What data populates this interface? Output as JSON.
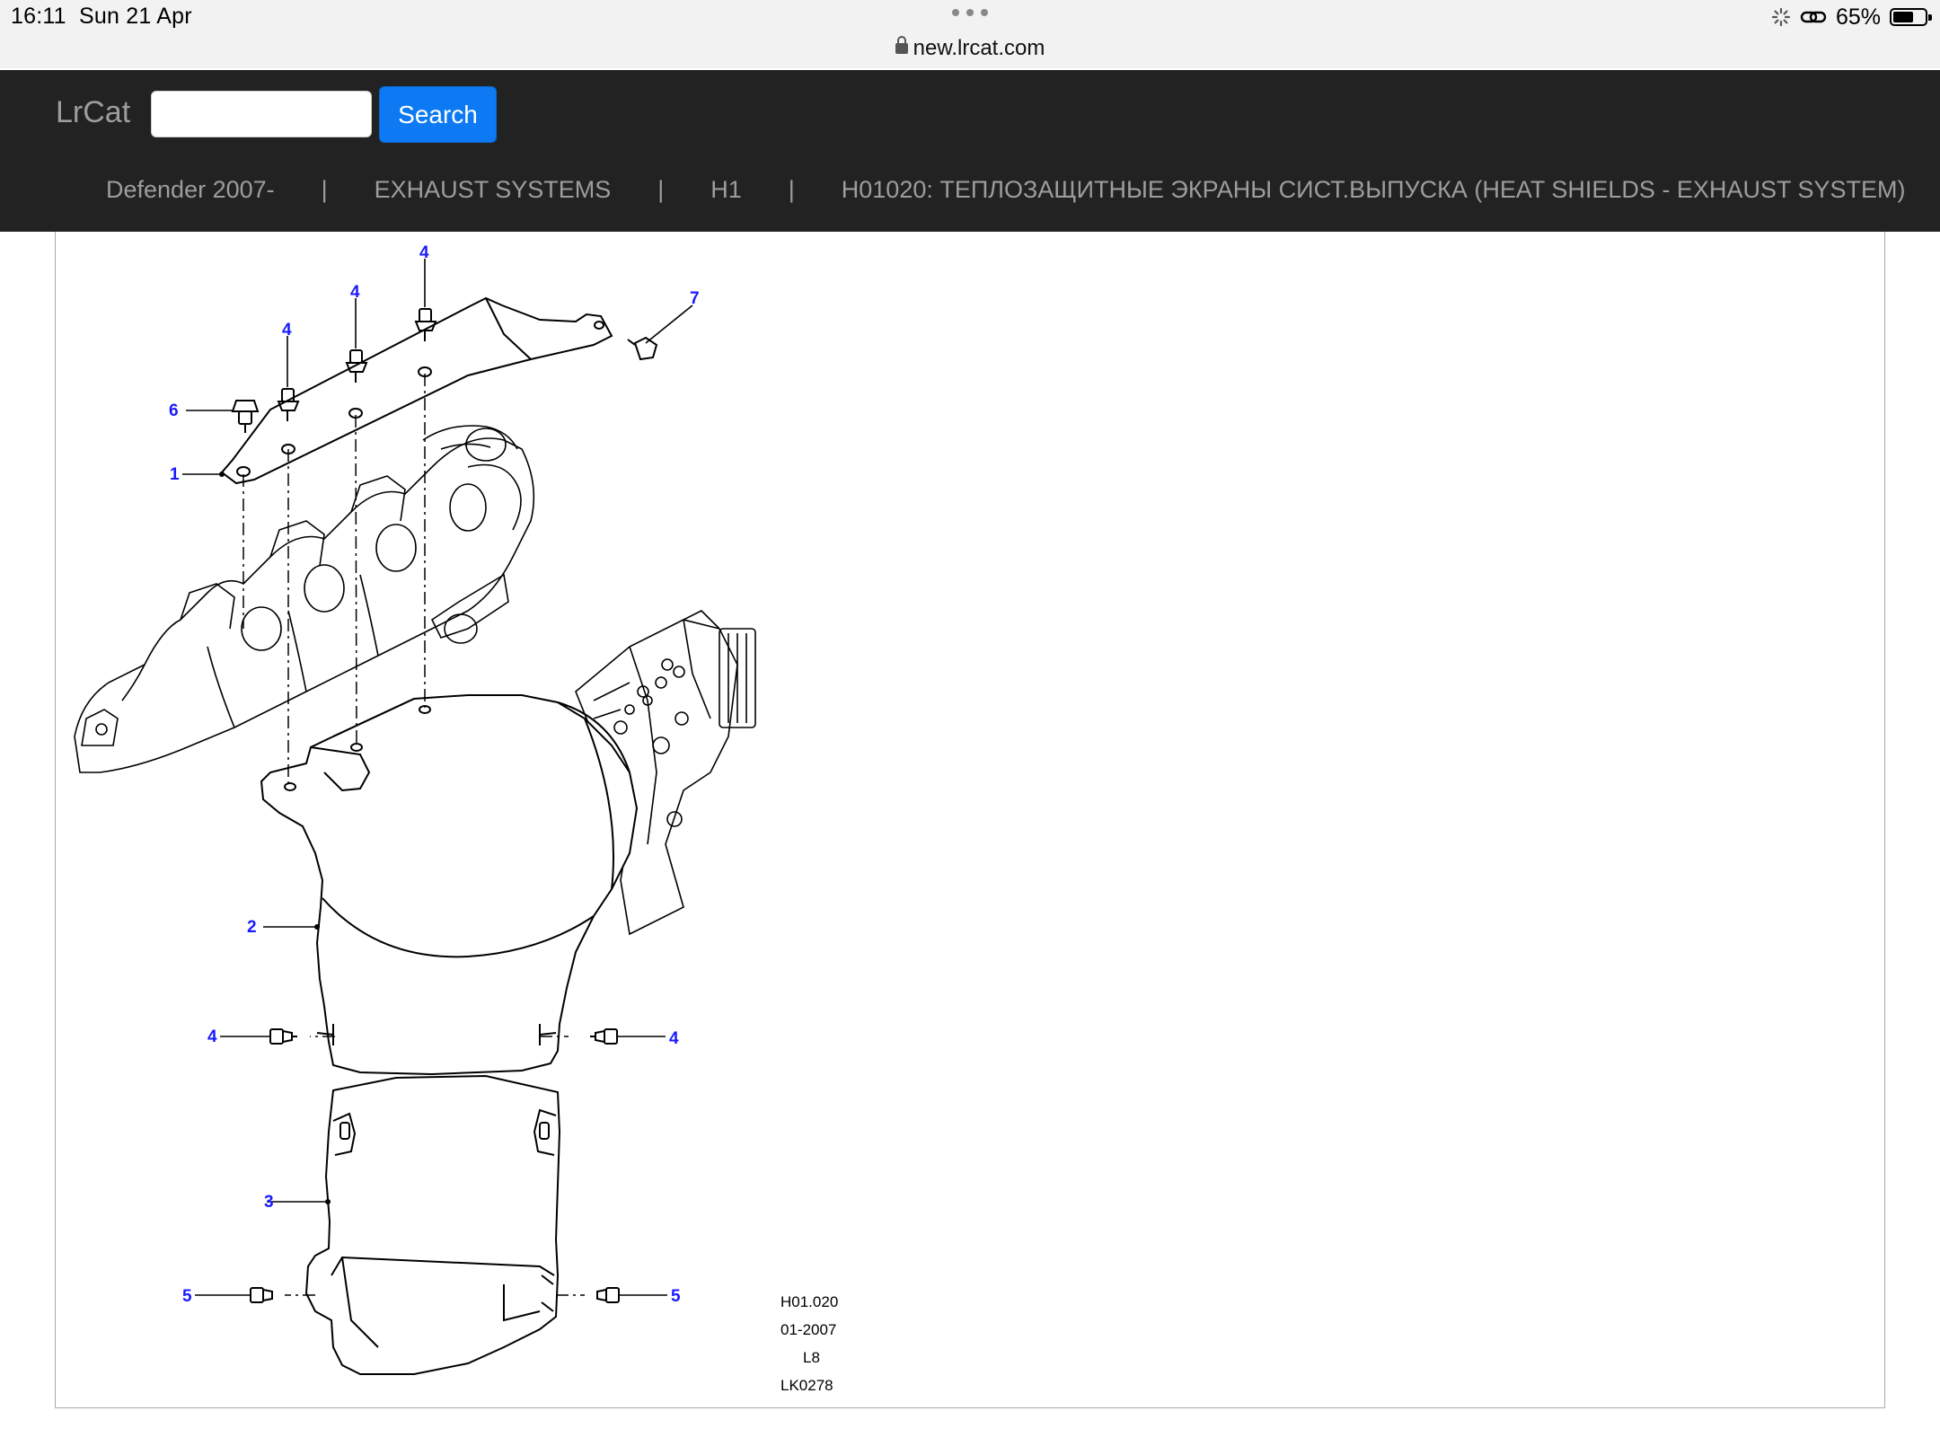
{
  "status_bar": {
    "time": "16:11",
    "date": "Sun 21 Apr",
    "url": "new.lrcat.com",
    "battery": "65%",
    "battery_level": 0.65
  },
  "navbar": {
    "brand": "LrCat",
    "search_placeholder": "",
    "search_button": "Search"
  },
  "breadcrumb": [
    "Defender 2007-",
    "EXHAUST SYSTEMS",
    "H1",
    "H01020: ТЕПЛОЗАЩИТНЫЕ ЭКРАНЫ СИСТ.ВЫПУСКА (HEAT SHIELDS - EXHAUST SYSTEM)"
  ],
  "breadcrumb_separator": "|",
  "diagram": {
    "callouts": {
      "c1": "1",
      "c2": "2",
      "c3": "3",
      "c4": "4",
      "c5": "5",
      "c6": "6",
      "c7": "7"
    },
    "stamp": {
      "ref": "H01.020",
      "date": "01-2007",
      "code1": "L8",
      "code2": "LK0278"
    },
    "callout_color": "#1a1aff"
  }
}
